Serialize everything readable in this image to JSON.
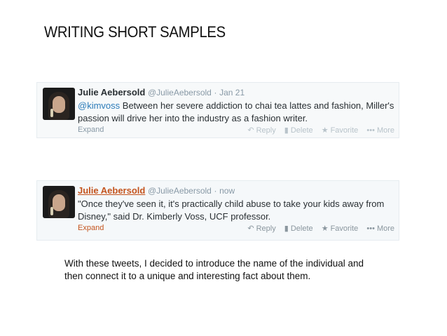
{
  "slide": {
    "title": "WRITING SHORT SAMPLES",
    "caption": "With these tweets, I decided to introduce the name of the individual and then connect it to a unique and interesting fact about them."
  },
  "tweets": [
    {
      "name": "Julie Aebersold",
      "handle": "@JulieAebersold",
      "separator": "·",
      "time": "Jan 21",
      "mention": "@kimvoss",
      "text": " Between her severe addiction to chai tea lattes and fashion, Miller's passion will drive her into the industry as a fashion writer.",
      "expand": "Expand",
      "actions": {
        "reply": "Reply",
        "delete": "Delete",
        "favorite": "Favorite",
        "more": "More"
      },
      "icons": {
        "reply": "reply-icon",
        "delete": "trash-icon",
        "favorite": "star-icon",
        "more": "ellipsis-icon"
      }
    },
    {
      "name": "Julie Aebersold",
      "handle": "@JulieAebersold",
      "separator": "·",
      "time": "now",
      "mention": "",
      "text": "\"Once they've seen it, it's practically child abuse to take your kids away from Disney,\" said Dr. Kimberly Voss, UCF professor.",
      "expand": "Expand",
      "actions": {
        "reply": "Reply",
        "delete": "Delete",
        "favorite": "Favorite",
        "more": "More"
      },
      "icons": {
        "reply": "reply-icon",
        "delete": "trash-icon",
        "favorite": "star-icon",
        "more": "ellipsis-icon"
      }
    }
  ],
  "colors": {
    "link": "#2b7bb9",
    "name_hover": "#c4541e",
    "muted": "#8899a6"
  }
}
